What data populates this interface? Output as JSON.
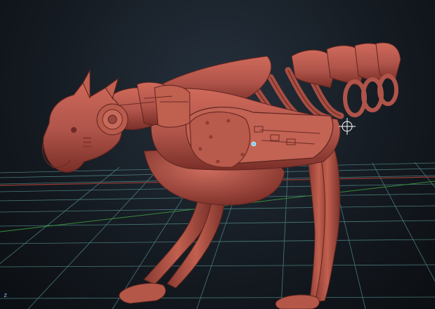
{
  "viewport": {
    "axis_indicator": "z",
    "colors": {
      "background_top": "#26313d",
      "background_bottom": "#0b0e12",
      "grid_line": "#5a9a98",
      "grid_axis_x": "#9a3b33",
      "grid_axis_z": "#3a8a3a",
      "model_base": "#b8584d",
      "model_shadow": "#6e2a24",
      "model_highlight": "#d67a6a",
      "pivot_point": "#6fd6ff",
      "cursor": "#ffffff"
    },
    "model": {
      "name_icon": "robotic-panther-sculpt",
      "material": "red-wax-matcap"
    },
    "cursor_icon": "crosshair-icon"
  }
}
